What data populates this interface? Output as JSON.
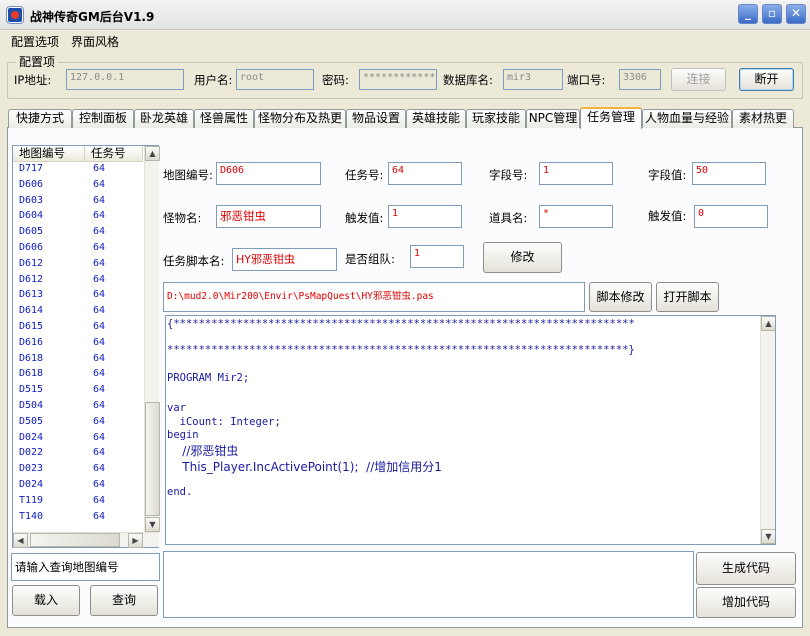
{
  "window": {
    "title": "战神传奇GM后台V1.9"
  },
  "menu": {
    "config": "配置选项",
    "style": "界面风格"
  },
  "config_group": {
    "title": "配置项",
    "ip_label": "IP地址:",
    "ip_value": "127.0.0.1",
    "user_label": "用户名:",
    "user_value": "root",
    "pwd_label": "密码:",
    "pwd_value": "************",
    "db_label": "数据库名:",
    "db_value": "mir3",
    "port_label": "端口号:",
    "port_value": "3306",
    "connect_label": "连接",
    "disconnect_label": "断开"
  },
  "tabs": [
    {
      "label": "快捷方式"
    },
    {
      "label": "控制面板"
    },
    {
      "label": "卧龙英雄"
    },
    {
      "label": "怪兽属性"
    },
    {
      "label": "怪物分布及热更"
    },
    {
      "label": "物品设置"
    },
    {
      "label": "英雄技能"
    },
    {
      "label": "玩家技能"
    },
    {
      "label": "NPC管理"
    },
    {
      "label": "任务管理"
    },
    {
      "label": "人物血量与经验"
    },
    {
      "label": "素材热更"
    }
  ],
  "active_tab": "任务管理",
  "list": {
    "col_map": "地图编号",
    "col_task": "任务号",
    "rows": [
      {
        "map": "D717",
        "task": "64"
      },
      {
        "map": "D606",
        "task": "64"
      },
      {
        "map": "D603",
        "task": "64"
      },
      {
        "map": "D604",
        "task": "64"
      },
      {
        "map": "D605",
        "task": "64"
      },
      {
        "map": "D606",
        "task": "64"
      },
      {
        "map": "D612",
        "task": "64"
      },
      {
        "map": "D612",
        "task": "64"
      },
      {
        "map": "D613",
        "task": "64"
      },
      {
        "map": "D614",
        "task": "64"
      },
      {
        "map": "D615",
        "task": "64"
      },
      {
        "map": "D616",
        "task": "64"
      },
      {
        "map": "D618",
        "task": "64"
      },
      {
        "map": "D618",
        "task": "64"
      },
      {
        "map": "D515",
        "task": "64"
      },
      {
        "map": "D504",
        "task": "64"
      },
      {
        "map": "D505",
        "task": "64"
      },
      {
        "map": "D024",
        "task": "64"
      },
      {
        "map": "D022",
        "task": "64"
      },
      {
        "map": "D023",
        "task": "64"
      },
      {
        "map": "D024",
        "task": "64"
      },
      {
        "map": "T119",
        "task": "64"
      },
      {
        "map": "T140",
        "task": "64"
      }
    ]
  },
  "form": {
    "map_label": "地图编号:",
    "map_value": "D606",
    "task_label": "任务号:",
    "task_value": "64",
    "fieldno_label": "字段号:",
    "fieldno_value": "1",
    "fieldval_label": "字段值:",
    "fieldval_value": "50",
    "monster_label": "怪物名:",
    "monster_value": "邪恶钳虫",
    "trigger_label": "触发值:",
    "trigger_value": "1",
    "item_label": "道具名:",
    "item_value": "*",
    "trigger2_label": "触发值:",
    "trigger2_value": "0",
    "script_label": "任务脚本名:",
    "script_value": "HY邪恶钳虫",
    "team_label": "是否组队:",
    "team_value": "1",
    "modify_label": "修改"
  },
  "script": {
    "path": "D:\\mud2.0\\Mir200\\Envir\\PsMapQuest\\HY邪恶钳虫.pas",
    "edit_label": "脚本修改",
    "open_label": "打开脚本",
    "lines": [
      "{*************************************************************************",
      "",
      "*************************************************************************}",
      "",
      "PROGRAM Mir2;",
      "",
      "var",
      "  iCount: Integer;",
      "begin",
      "    //邪恶钳虫",
      "    This_Player.IncActivePoint(1);  //增加信用分1",
      "",
      "end."
    ]
  },
  "bottom": {
    "query_value": "请输入查询地图编号",
    "load_label": "载入",
    "query_label": "查询",
    "generate_label": "生成代码",
    "add_label": "增加代码"
  }
}
